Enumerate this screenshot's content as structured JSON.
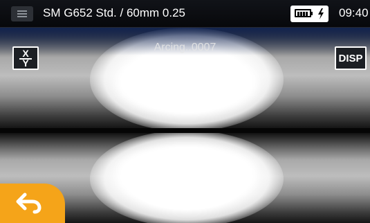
{
  "statusbar": {
    "menu_icon": "hamburger-menu-icon",
    "title": "SM G652 Std. / 60mm 0.25",
    "battery_icon": "battery-full-icon",
    "charging_icon": "lightning-bolt-icon",
    "clock": "09:40"
  },
  "viewer": {
    "status": "Arcing..0007",
    "xy_button": {
      "top": "X",
      "bottom": "Y"
    },
    "disp_button": "DISP"
  },
  "footer": {
    "back_icon": "back-arrow-icon"
  },
  "colors": {
    "accent": "#f5a419",
    "topbar": "#0a0b0e"
  }
}
